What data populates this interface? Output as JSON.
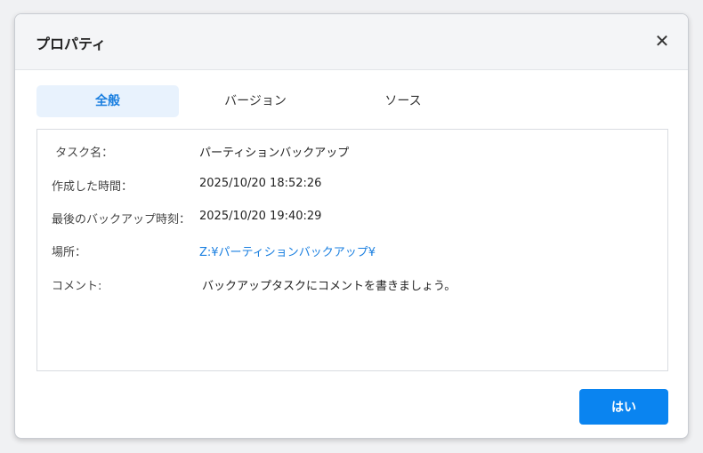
{
  "dialog": {
    "title": "プロパティ",
    "close_icon": "close-icon"
  },
  "tabs": [
    {
      "label": "全般",
      "active": true
    },
    {
      "label": "バージョン",
      "active": false
    },
    {
      "label": "ソース",
      "active": false
    }
  ],
  "properties": {
    "task_name_label": " タスク名：",
    "task_name_value": "パーティションバックアップ",
    "created_label": "作成した時間：",
    "created_value": "2025/10/20 18:52:26",
    "last_backup_label": "最後のバックアップ時刻：",
    "last_backup_value": "2025/10/20 19:40:29",
    "location_label": "場所：",
    "location_value": "Z:¥パーティションバックアップ¥",
    "comment_label": "コメント:",
    "comment_value": "バックアップタスクにコメントを書きましょう。"
  },
  "footer": {
    "ok_label": "はい"
  },
  "colors": {
    "accent": "#0a84f0",
    "link": "#1a7fe0",
    "tab_active_bg": "#e8f2fd"
  }
}
